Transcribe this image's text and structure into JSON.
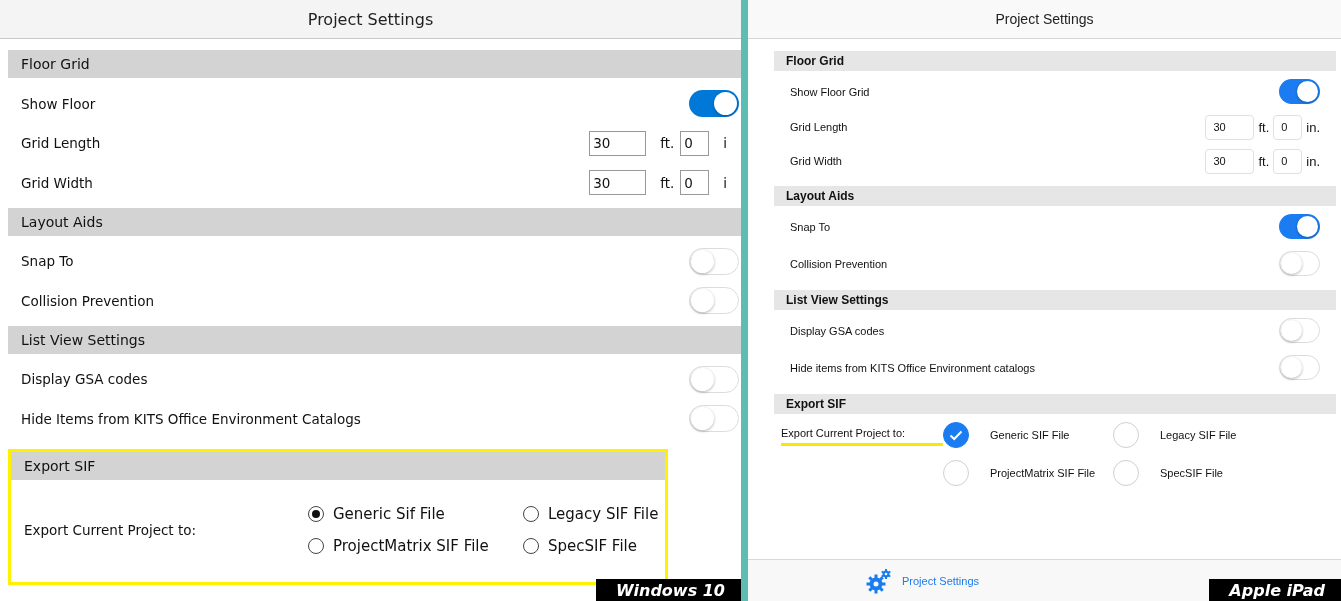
{
  "panels": [
    {
      "kind": "windows",
      "title": "Project Settings",
      "caption": "Windows 10",
      "sections": [
        {
          "title": "Floor Grid",
          "highlighted": false,
          "rows": [
            {
              "kind": "toggle",
              "label": "Show Floor",
              "on": true
            },
            {
              "kind": "dimension",
              "label": "Grid Length",
              "feet": "30",
              "feet_unit": "ft.",
              "inches": "0",
              "inches_unit": "i"
            },
            {
              "kind": "dimension",
              "label": "Grid Width",
              "feet": "30",
              "feet_unit": "ft.",
              "inches": "0",
              "inches_unit": "i"
            }
          ]
        },
        {
          "title": "Layout Aids",
          "highlighted": false,
          "rows": [
            {
              "kind": "toggle",
              "label": "Snap To",
              "on": false
            },
            {
              "kind": "toggle",
              "label": "Collision Prevention",
              "on": false
            }
          ]
        },
        {
          "title": "List View Settings",
          "highlighted": false,
          "rows": [
            {
              "kind": "toggle",
              "label": "Display GSA codes",
              "on": false
            },
            {
              "kind": "toggle",
              "label": "Hide Items from KITS Office Environment Catalogs",
              "on": false
            }
          ]
        },
        {
          "title": "Export SIF",
          "highlighted": true,
          "rows": [
            {
              "kind": "radio",
              "label": "Export Current Project to:",
              "options": [
                {
                  "label": "Generic Sif File",
                  "selected": true
                },
                {
                  "label": "Legacy SIF File",
                  "selected": false
                },
                {
                  "label": "ProjectMatrix SIF File",
                  "selected": false
                },
                {
                  "label": "SpecSIF File",
                  "selected": false
                }
              ]
            }
          ]
        }
      ]
    },
    {
      "kind": "ipad",
      "title": "Project Settings",
      "caption": "Apple iPad",
      "sections": [
        {
          "title": "Floor Grid",
          "highlighted": false,
          "rows": [
            {
              "kind": "toggle",
              "label": "Show Floor Grid",
              "on": true
            },
            {
              "kind": "dimension",
              "label": "Grid Length",
              "feet": "30",
              "feet_unit": "ft.",
              "inches": "0",
              "inches_unit": "in."
            },
            {
              "kind": "dimension",
              "label": "Grid Width",
              "feet": "30",
              "feet_unit": "ft.",
              "inches": "0",
              "inches_unit": "in."
            }
          ]
        },
        {
          "title": "Layout Aids",
          "highlighted": false,
          "rows": [
            {
              "kind": "toggle",
              "label": "Snap To",
              "on": true
            },
            {
              "kind": "toggle",
              "label": "Collision Prevention",
              "on": false
            }
          ]
        },
        {
          "title": "List View Settings",
          "highlighted": false,
          "rows": [
            {
              "kind": "toggle",
              "label": "Display GSA codes",
              "on": false
            },
            {
              "kind": "toggle",
              "label": "Hide items from KITS Office Environment catalogs",
              "on": false
            }
          ]
        },
        {
          "title": "Export SIF",
          "highlighted": true,
          "rows": [
            {
              "kind": "radio",
              "label": "Export Current Project to:",
              "options": [
                {
                  "label": "Generic SIF File",
                  "selected": true
                },
                {
                  "label": "Legacy SIF File",
                  "selected": false
                },
                {
                  "label": "ProjectMatrix SIF File",
                  "selected": false
                },
                {
                  "label": "SpecSIF File",
                  "selected": false
                }
              ]
            }
          ]
        }
      ],
      "tab_bar": [
        {
          "label": "Project Settings",
          "selected": true
        }
      ]
    }
  ]
}
